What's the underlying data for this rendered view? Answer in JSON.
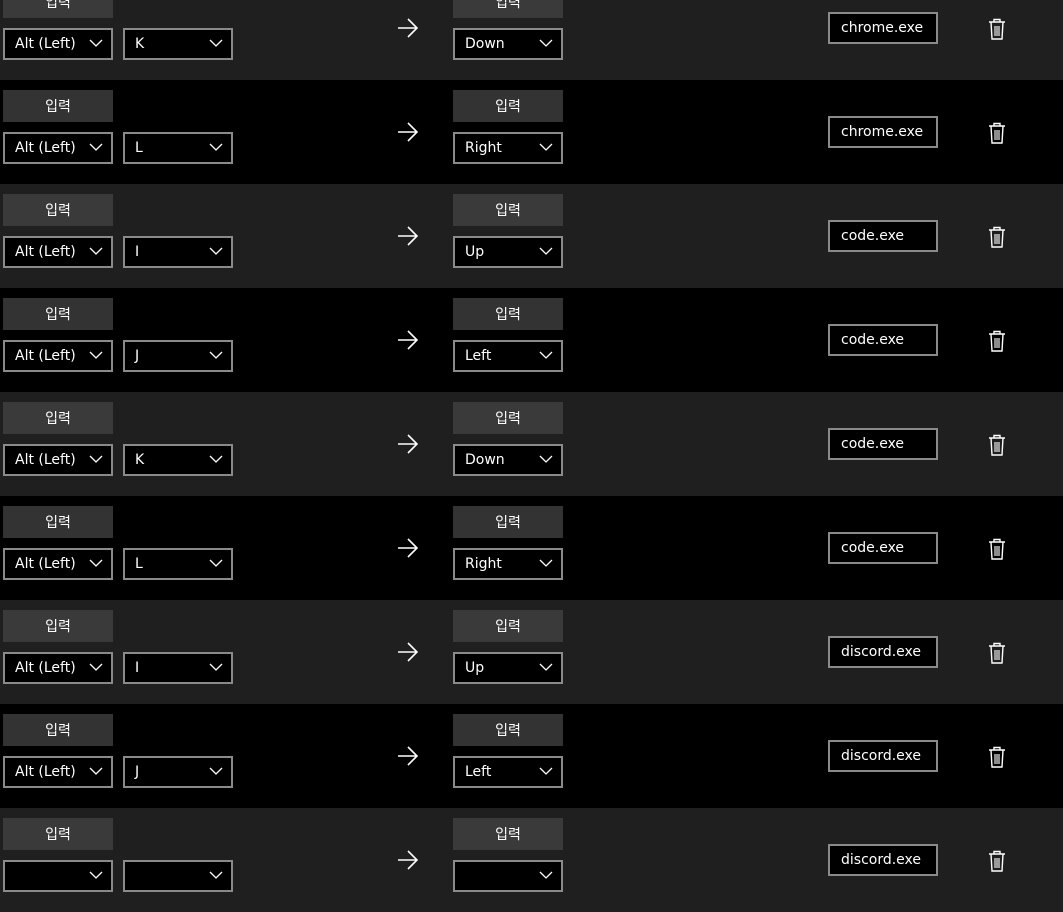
{
  "type_button_label": "입력",
  "rows": [
    {
      "modifier": "Alt (Left)",
      "key": "K",
      "target": "Down",
      "app": "chrome.exe"
    },
    {
      "modifier": "Alt (Left)",
      "key": "L",
      "target": "Right",
      "app": "chrome.exe"
    },
    {
      "modifier": "Alt (Left)",
      "key": "I",
      "target": "Up",
      "app": "code.exe"
    },
    {
      "modifier": "Alt (Left)",
      "key": "J",
      "target": "Left",
      "app": "code.exe"
    },
    {
      "modifier": "Alt (Left)",
      "key": "K",
      "target": "Down",
      "app": "code.exe"
    },
    {
      "modifier": "Alt (Left)",
      "key": "L",
      "target": "Right",
      "app": "code.exe"
    },
    {
      "modifier": "Alt (Left)",
      "key": "I",
      "target": "Up",
      "app": "discord.exe"
    },
    {
      "modifier": "Alt (Left)",
      "key": "J",
      "target": "Left",
      "app": "discord.exe"
    },
    {
      "modifier": "",
      "key": "",
      "target": "",
      "app": "discord.exe"
    }
  ],
  "icons": {
    "dropdown": "chevron-down-icon",
    "mapping": "arrow-right-icon",
    "delete": "trash-icon"
  },
  "colors": {
    "row_alt_background": "#1f1f1f",
    "row_background": "#000000",
    "button_background": "#3a3a3a",
    "field_border": "#8a8a8a"
  }
}
